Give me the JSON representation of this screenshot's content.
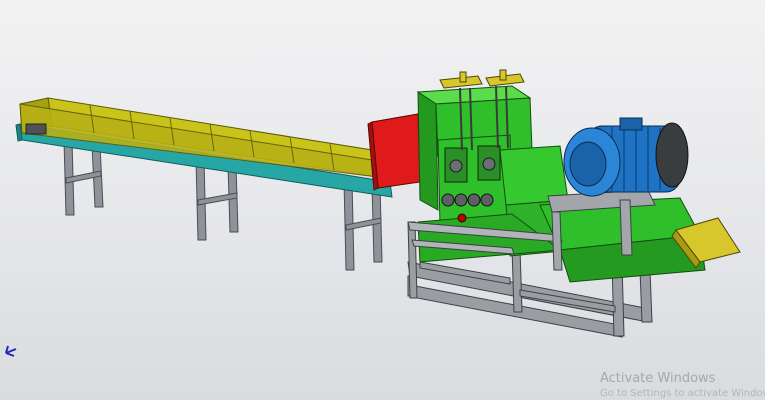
{
  "colors": {
    "background_top": "#f2f2f3",
    "background_bottom": "#d9dbdf",
    "conveyor_trough": "#c9c31a",
    "conveyor_base": "#27a6a6",
    "frame_steel": "#9a9ea3",
    "machine_body": "#2fbf2a",
    "hopper_red": "#e01a1a",
    "motor_blue": "#1e73c4",
    "adjuster_yellow": "#d8c72a"
  },
  "icons": {
    "axis_triad": "coordinate-triad-icon"
  },
  "watermark": {
    "title": "Activate Windows",
    "subtitle": "Go to Settings to activate Windows."
  }
}
